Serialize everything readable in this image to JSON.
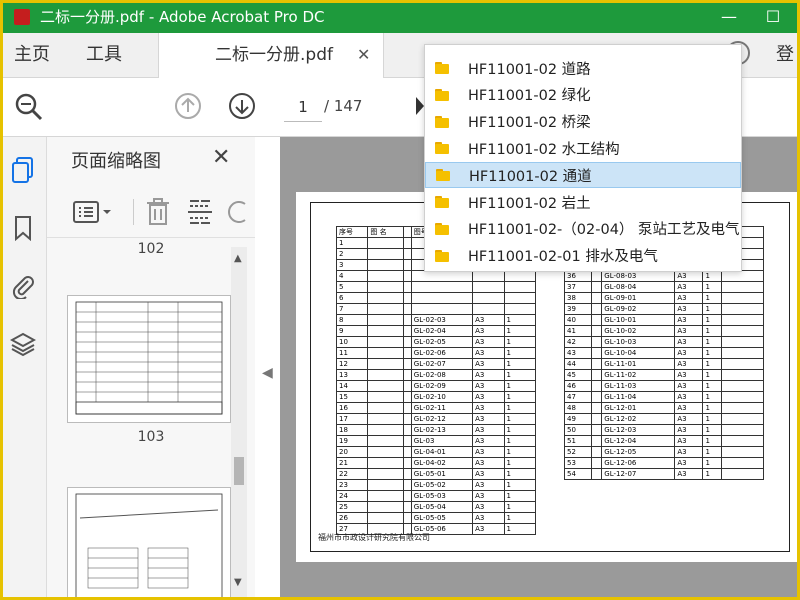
{
  "window": {
    "title": "二标一分册.pdf - Adobe Acrobat Pro DC",
    "minimize": "—",
    "maximize": "☐"
  },
  "menubar": {
    "home": "主页",
    "tools": "工具",
    "tab_name": "二标一分册.pdf",
    "tab_close": "✕",
    "help": "?",
    "login": "登"
  },
  "toolbar": {
    "page_current": "1",
    "page_total": "/ 147"
  },
  "panel": {
    "title": "页面缩略图",
    "close": "✕",
    "thumbnails": [
      {
        "label": "102"
      },
      {
        "label": "103"
      }
    ]
  },
  "dropdown": {
    "items": [
      {
        "label": "HF11001-02 道路",
        "selected": false
      },
      {
        "label": "HF11001-02 绿化",
        "selected": false
      },
      {
        "label": "HF11001-02 桥梁",
        "selected": false
      },
      {
        "label": "HF11001-02 水工结构",
        "selected": false
      },
      {
        "label": "HF11001-02 通道",
        "selected": true
      },
      {
        "label": "HF11001-02 岩土",
        "selected": false
      },
      {
        "label": "HF11001-02-（02-04） 泵站工艺及电气",
        "selected": false
      },
      {
        "label": "HF11001-02-01 排水及电气",
        "selected": false
      }
    ]
  },
  "document": {
    "left_table": {
      "headers": [
        "序号",
        "图 名",
        "",
        "图号",
        "规格",
        "张数"
      ],
      "rows": [
        [
          "1",
          "",
          "",
          "",
          "",
          ""
        ],
        [
          "2",
          "",
          "",
          "",
          "",
          ""
        ],
        [
          "3",
          "",
          "",
          "",
          "",
          ""
        ],
        [
          "4",
          "",
          "",
          "",
          "",
          ""
        ],
        [
          "5",
          "",
          "",
          "",
          "",
          ""
        ],
        [
          "6",
          "",
          "",
          "",
          "",
          ""
        ],
        [
          "7",
          "",
          "",
          "",
          "",
          ""
        ],
        [
          "8",
          "",
          "",
          "",
          "",
          ""
        ],
        [
          "9",
          "",
          "",
          "",
          "",
          ""
        ],
        [
          "10",
          "",
          "",
          "",
          "",
          ""
        ],
        [
          "11",
          "",
          "",
          "",
          "",
          ""
        ],
        [
          "12",
          "",
          "",
          "",
          "",
          ""
        ],
        [
          "13",
          "",
          "",
          "",
          "",
          ""
        ],
        [
          "14",
          "",
          "",
          "",
          "",
          ""
        ],
        [
          "15",
          "",
          "",
          "",
          "",
          ""
        ],
        [
          "16",
          "",
          "",
          "",
          "",
          ""
        ],
        [
          "17",
          "",
          "",
          "",
          "",
          ""
        ],
        [
          "18",
          "",
          "",
          "",
          "",
          ""
        ],
        [
          "19",
          "",
          "",
          "",
          "",
          ""
        ],
        [
          "20",
          "",
          "",
          "",
          "",
          ""
        ],
        [
          "21",
          "",
          "",
          "",
          "",
          ""
        ],
        [
          "22",
          "",
          "",
          "",
          "",
          ""
        ],
        [
          "23",
          "",
          "",
          "",
          "",
          ""
        ],
        [
          "24",
          "",
          "",
          "",
          "",
          ""
        ],
        [
          "25",
          "",
          "",
          "",
          "",
          ""
        ],
        [
          "26",
          "",
          "",
          "",
          "",
          ""
        ],
        [
          "27",
          "",
          "",
          "",
          "",
          ""
        ]
      ],
      "row_codes": [
        "GL-02-03",
        "GL-02-04",
        "GL-02-05",
        "GL-02-06",
        "GL-02-07",
        "GL-02-08",
        "GL-02-09",
        "GL-02-10",
        "GL-02-11",
        "GL-02-12",
        "GL-02-13",
        "GL-03",
        "GL-04-01",
        "GL-04-02",
        "GL-05-01",
        "GL-05-02",
        "GL-05-03",
        "GL-05-04",
        "GL-05-05",
        "GL-05-06"
      ]
    },
    "right_table": {
      "headers": [
        "备 注"
      ],
      "rows_start": 33,
      "rows_end": 54,
      "codes": [
        "GL-07",
        "GL-08-01",
        "GL-08-02",
        "GL-08-03",
        "GL-08-04",
        "GL-09-01",
        "GL-09-02",
        "GL-10-01",
        "GL-10-02",
        "GL-10-03",
        "GL-10-04",
        "GL-11-01",
        "GL-11-02",
        "GL-11-03",
        "GL-11-04",
        "GL-12-01",
        "GL-12-02",
        "GL-12-03",
        "GL-12-04",
        "GL-12-05",
        "GL-12-06",
        "GL-12-07"
      ],
      "spec": "A3",
      "qty": "1"
    },
    "footer_company": "福州市市政设计研究院有限公司"
  }
}
